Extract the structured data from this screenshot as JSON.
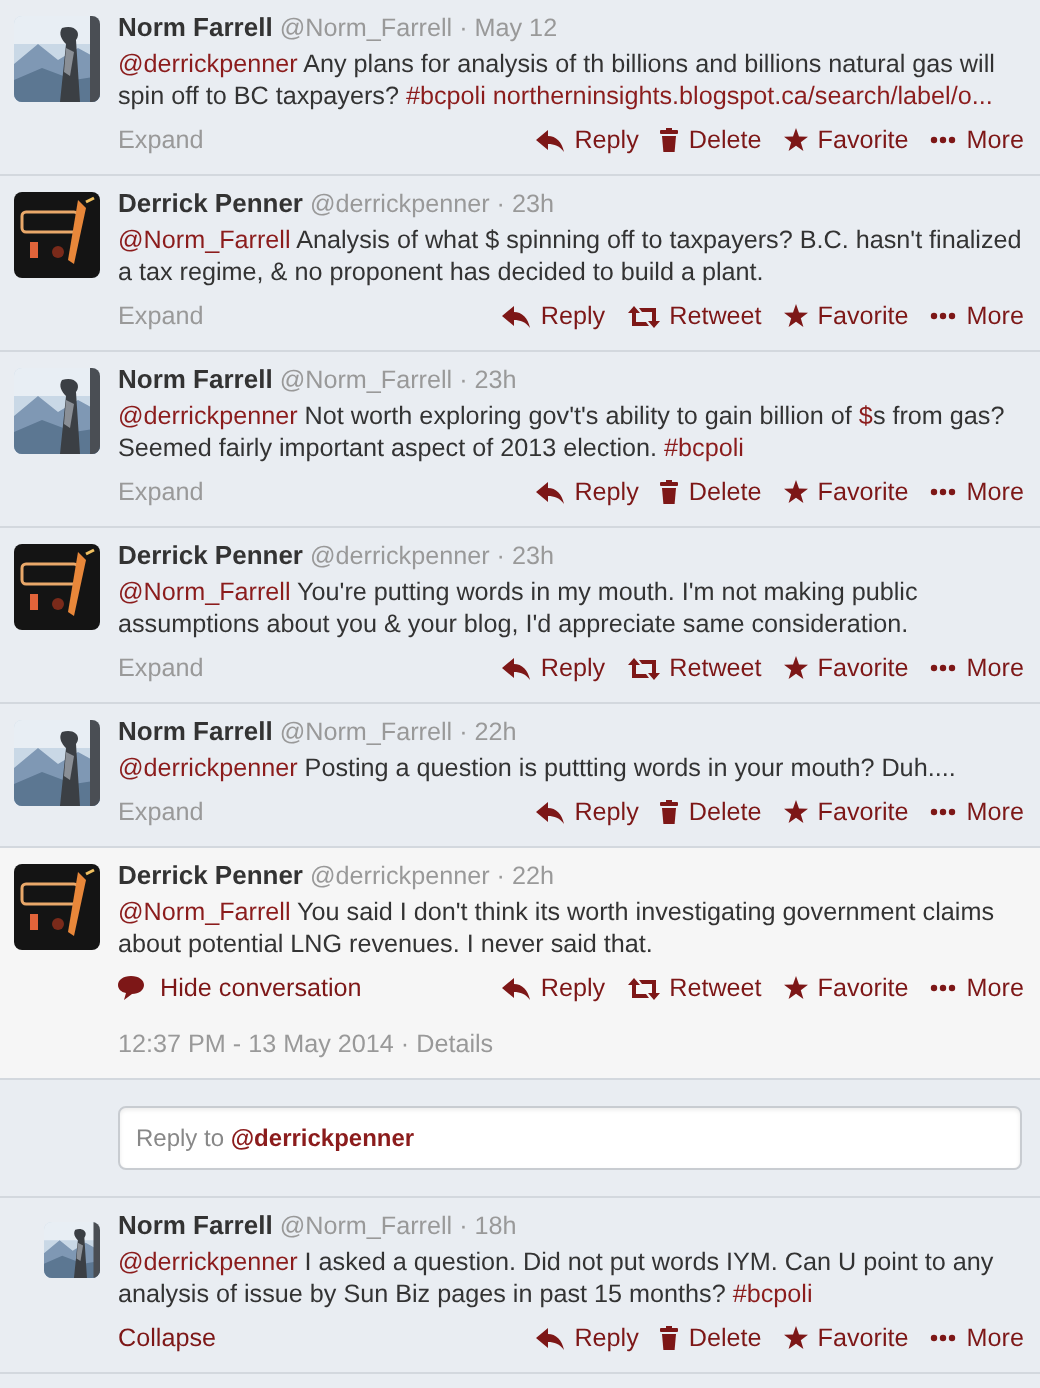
{
  "thread": [
    {
      "kind": "tweet",
      "author": "Norm Farrell",
      "handle": "@Norm_Farrell",
      "time": "· May 12",
      "segments": [
        {
          "kind": "link",
          "text": "@derrickpenner"
        },
        {
          "kind": "plain",
          "text": " Any plans for analysis of th billions and billions natural gas will spin off to BC taxpayers? "
        },
        {
          "kind": "link",
          "text": "#bcpoli "
        },
        {
          "kind": "link",
          "text": "northerninsights.blogspot.ca/search/label/o..."
        }
      ],
      "toggle": {
        "kind": "expand",
        "label": "Expand"
      },
      "actions": [
        {
          "kind": "reply",
          "label": "Reply"
        },
        {
          "kind": "delete",
          "label": "Delete"
        },
        {
          "kind": "favorite",
          "label": "Favorite"
        },
        {
          "kind": "more",
          "label": "More"
        }
      ],
      "expanded": false
    },
    {
      "kind": "tweet",
      "author": "Derrick Penner",
      "handle": "@derrickpenner",
      "time": "· 23h",
      "segments": [
        {
          "kind": "link",
          "text": "@Norm_Farrell"
        },
        {
          "kind": "plain",
          "text": " Analysis of what $ spinning off to taxpayers? B.C. hasn't finalized a tax regime, & no proponent has decided to build a plant."
        }
      ],
      "toggle": {
        "kind": "expand",
        "label": "Expand"
      },
      "actions": [
        {
          "kind": "reply",
          "label": "Reply"
        },
        {
          "kind": "retweet",
          "label": "Retweet"
        },
        {
          "kind": "favorite",
          "label": "Favorite"
        },
        {
          "kind": "more",
          "label": "More"
        }
      ],
      "expanded": false
    },
    {
      "kind": "tweet",
      "author": "Norm Farrell",
      "handle": "@Norm_Farrell",
      "time": "· 23h",
      "segments": [
        {
          "kind": "link",
          "text": "@derrickpenner"
        },
        {
          "kind": "plain",
          "text": " Not worth exploring gov't's ability to gain billion of "
        },
        {
          "kind": "link",
          "text": "$"
        },
        {
          "kind": "plain",
          "text": "s from gas? Seemed fairly important aspect of 2013 election. "
        },
        {
          "kind": "link",
          "text": "#bcpoli"
        }
      ],
      "toggle": {
        "kind": "expand",
        "label": "Expand"
      },
      "actions": [
        {
          "kind": "reply",
          "label": "Reply"
        },
        {
          "kind": "delete",
          "label": "Delete"
        },
        {
          "kind": "favorite",
          "label": "Favorite"
        },
        {
          "kind": "more",
          "label": "More"
        }
      ],
      "expanded": false
    },
    {
      "kind": "tweet",
      "author": "Derrick Penner",
      "handle": "@derrickpenner",
      "time": "· 23h",
      "segments": [
        {
          "kind": "link",
          "text": "@Norm_Farrell"
        },
        {
          "kind": "plain",
          "text": " You're putting words in my mouth. I'm not making public assumptions about you & your blog, I'd appreciate same consideration."
        }
      ],
      "toggle": {
        "kind": "expand",
        "label": "Expand"
      },
      "actions": [
        {
          "kind": "reply",
          "label": "Reply"
        },
        {
          "kind": "retweet",
          "label": "Retweet"
        },
        {
          "kind": "favorite",
          "label": "Favorite"
        },
        {
          "kind": "more",
          "label": "More"
        }
      ],
      "expanded": false
    },
    {
      "kind": "tweet",
      "author": "Norm Farrell",
      "handle": "@Norm_Farrell",
      "time": "· 22h",
      "segments": [
        {
          "kind": "link",
          "text": "@derrickpenner"
        },
        {
          "kind": "plain",
          "text": " Posting a question is puttting words in your mouth? Duh...."
        }
      ],
      "toggle": {
        "kind": "expand",
        "label": "Expand"
      },
      "actions": [
        {
          "kind": "reply",
          "label": "Reply"
        },
        {
          "kind": "delete",
          "label": "Delete"
        },
        {
          "kind": "favorite",
          "label": "Favorite"
        },
        {
          "kind": "more",
          "label": "More"
        }
      ],
      "expanded": false
    },
    {
      "kind": "tweet",
      "author": "Derrick Penner",
      "handle": "@derrickpenner",
      "time": "· 22h",
      "segments": [
        {
          "kind": "link",
          "text": "@Norm_Farrell"
        },
        {
          "kind": "plain",
          "text": " You said I don't think its worth investigating government claims about potential LNG revenues. I never said that."
        }
      ],
      "toggle": {
        "kind": "hide",
        "label": "Hide conversation"
      },
      "actions": [
        {
          "kind": "reply",
          "label": "Reply"
        },
        {
          "kind": "retweet",
          "label": "Retweet"
        },
        {
          "kind": "favorite",
          "label": "Favorite"
        },
        {
          "kind": "more",
          "label": "More"
        }
      ],
      "expanded": true,
      "timestamp": "12:37 PM - 13 May 2014 ·",
      "details_link": "Details"
    },
    {
      "kind": "reply_box",
      "segments": [
        {
          "kind": "plain",
          "text": "Reply to "
        },
        {
          "kind": "link",
          "text": "@derrickpenner"
        }
      ]
    },
    {
      "kind": "nested_tweet",
      "author": "Norm Farrell",
      "handle": "@Norm_Farrell",
      "time": "· 18h",
      "segments": [
        {
          "kind": "link",
          "text": "@derrickpenner"
        },
        {
          "kind": "plain",
          "text": " I asked a question. Did not put words IYM. Can U point to any analysis of issue by Sun Biz pages in past 15 months? "
        },
        {
          "kind": "link",
          "text": "#bcpoli"
        }
      ],
      "toggle": {
        "kind": "collapse",
        "label": "Collapse"
      },
      "actions": [
        {
          "kind": "reply",
          "label": "Reply"
        },
        {
          "kind": "delete",
          "label": "Delete"
        },
        {
          "kind": "favorite",
          "label": "Favorite"
        },
        {
          "kind": "more",
          "label": "More"
        }
      ],
      "expanded": false
    }
  ]
}
